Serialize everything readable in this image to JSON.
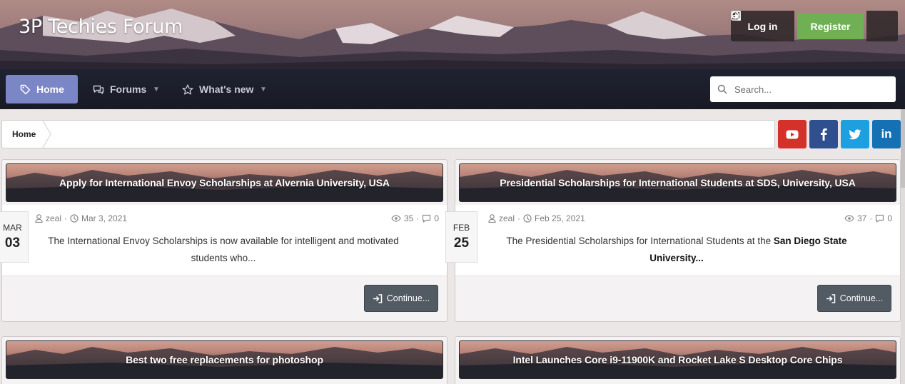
{
  "header": {
    "site_title": "3P Techies Forum",
    "login_label": "Log in",
    "register_label": "Register"
  },
  "nav": {
    "items": [
      {
        "label": "Home",
        "icon": "tag-icon",
        "active": true
      },
      {
        "label": "Forums",
        "icon": "comments-icon",
        "has_dropdown": true
      },
      {
        "label": "What's new",
        "icon": "star-icon",
        "has_dropdown": true
      }
    ],
    "search_placeholder": "Search..."
  },
  "breadcrumb": {
    "home": "Home"
  },
  "social": {
    "items": [
      {
        "name": "youtube",
        "color": "#d3312a"
      },
      {
        "name": "facebook",
        "color": "#2f4f8f"
      },
      {
        "name": "twitter",
        "color": "#1e9fe0"
      },
      {
        "name": "linkedin",
        "color": "#1671b4",
        "glyph": "in"
      }
    ]
  },
  "articles": [
    {
      "title": "Apply for International Envoy Scholarships at Alvernia University, USA",
      "date_month": "MAR",
      "date_day": "03",
      "author": "zeal",
      "date": "Mar 3, 2021",
      "views": "35",
      "replies": "0",
      "excerpt": "The International Envoy Scholarships is now available for intelligent and motivated students who...",
      "continue_label": "Continue..."
    },
    {
      "title": "Presidential Scholarships for International Students at SDS, University, USA",
      "date_month": "FEB",
      "date_day": "25",
      "author": "zeal",
      "date": "Feb 25, 2021",
      "views": "37",
      "replies": "0",
      "excerpt_prefix": "The Presidential Scholarships for International Students at the ",
      "excerpt_bold": "San Diego State University...",
      "continue_label": "Continue..."
    },
    {
      "title": "Best two free replacements for photoshop"
    },
    {
      "title": "Intel Launches Core i9-11900K and Rocket Lake S Desktop Core Chips"
    }
  ],
  "colors": {
    "accent": "#7b86c6",
    "register": "#6fb054",
    "nav_background": "#1f2230",
    "button_dark": "#525a63"
  }
}
